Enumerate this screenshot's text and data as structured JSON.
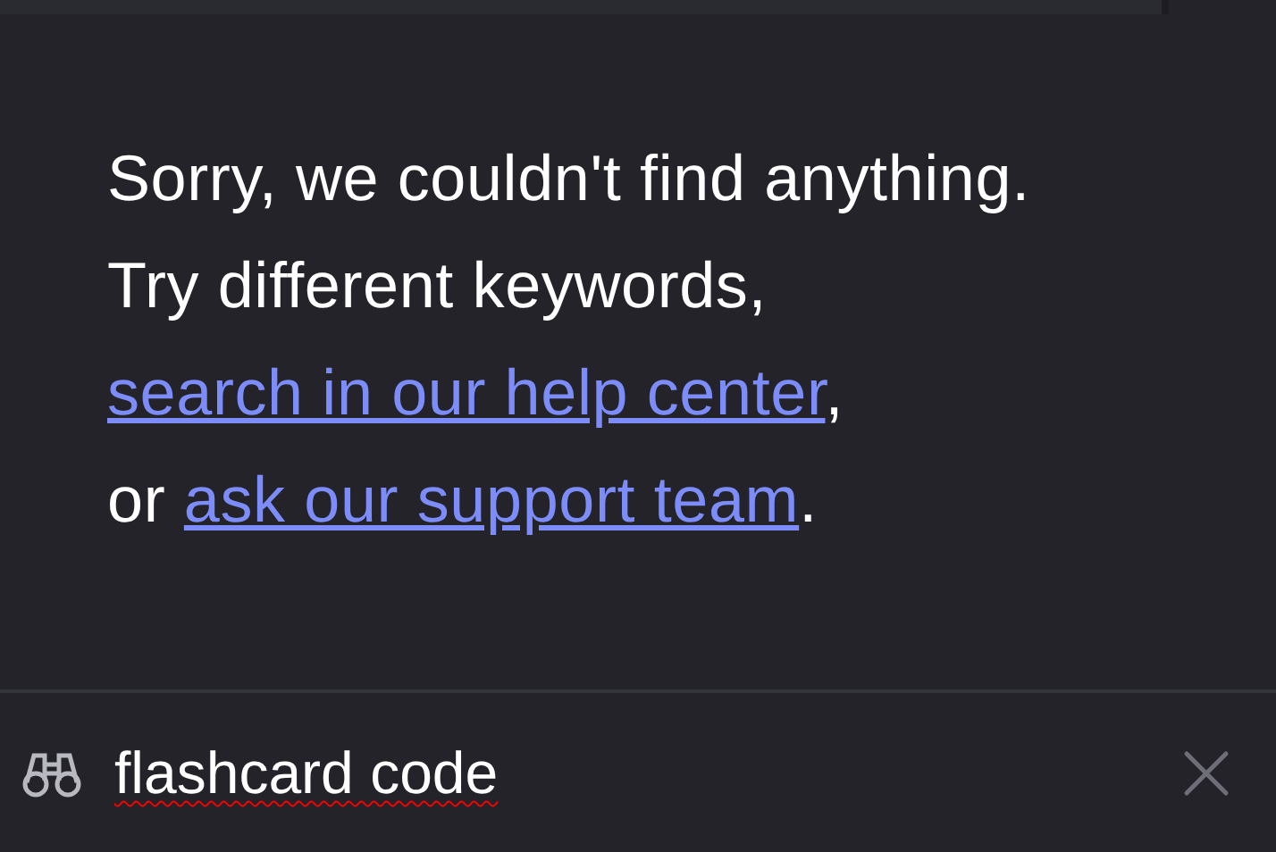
{
  "message": {
    "lines": [
      [
        {
          "kind": "text",
          "text": "Sorry, we couldn't find anything."
        }
      ],
      [
        {
          "kind": "text",
          "text": "Try different keywords,"
        }
      ],
      [
        {
          "kind": "link",
          "text": "search in our help center"
        },
        {
          "kind": "text",
          "text": ","
        }
      ],
      [
        {
          "kind": "text",
          "text": "or "
        },
        {
          "kind": "link",
          "text": "ask our support team"
        },
        {
          "kind": "text",
          "text": "."
        }
      ]
    ]
  },
  "search": {
    "value": "flashcard code",
    "spelling_flagged": true
  }
}
